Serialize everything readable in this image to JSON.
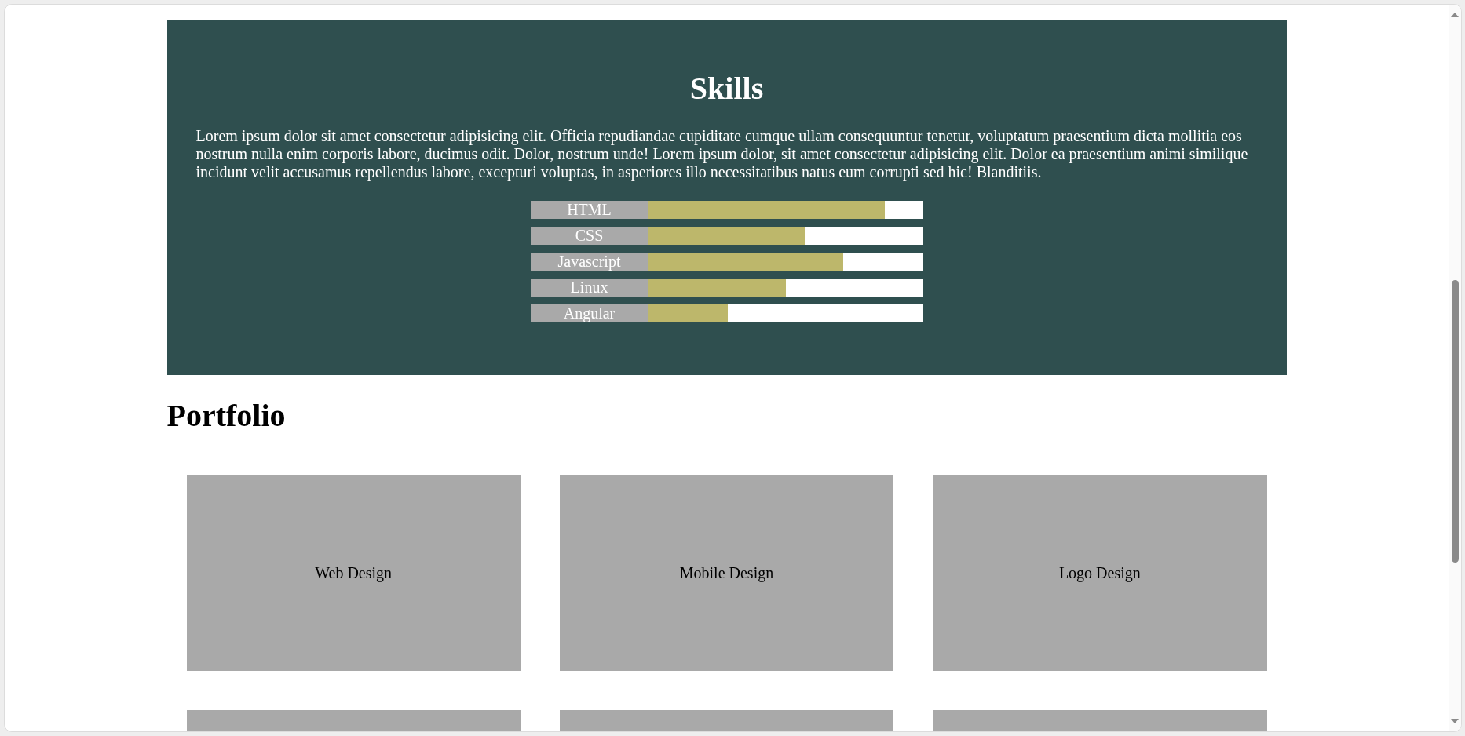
{
  "skills": {
    "title": "Skills",
    "description": "Lorem ipsum dolor sit amet consectetur adipisicing elit. Officia repudiandae cupiditate cumque ullam consequuntur tenetur, voluptatum praesentium dicta mollitia eos nostrum nulla enim corporis labore, ducimus odit. Dolor, nostrum unde! Lorem ipsum dolor, sit amet consectetur adipisicing elit. Dolor ea praesentium animi similique incidunt velit accusamus repellendus labore, excepturi voluptas, in asperiores illo necessitatibus natus eum corrupti sed hic! Blanditiis.",
    "bars": [
      {
        "name": "HTML",
        "level": 0.86
      },
      {
        "name": "CSS",
        "level": 0.57
      },
      {
        "name": "Javascript",
        "level": 0.71
      },
      {
        "name": "Linux",
        "level": 0.5
      },
      {
        "name": "Angular",
        "level": 0.29
      }
    ]
  },
  "portfolio": {
    "title": "Portfolio",
    "items": [
      {
        "kind": "card",
        "label": "Web Design"
      },
      {
        "kind": "card",
        "label": "Mobile Design"
      },
      {
        "kind": "card",
        "label": "Logo Design"
      },
      {
        "kind": "cut_off"
      },
      {
        "kind": "cut_off"
      },
      {
        "kind": "cut_off"
      }
    ]
  }
}
